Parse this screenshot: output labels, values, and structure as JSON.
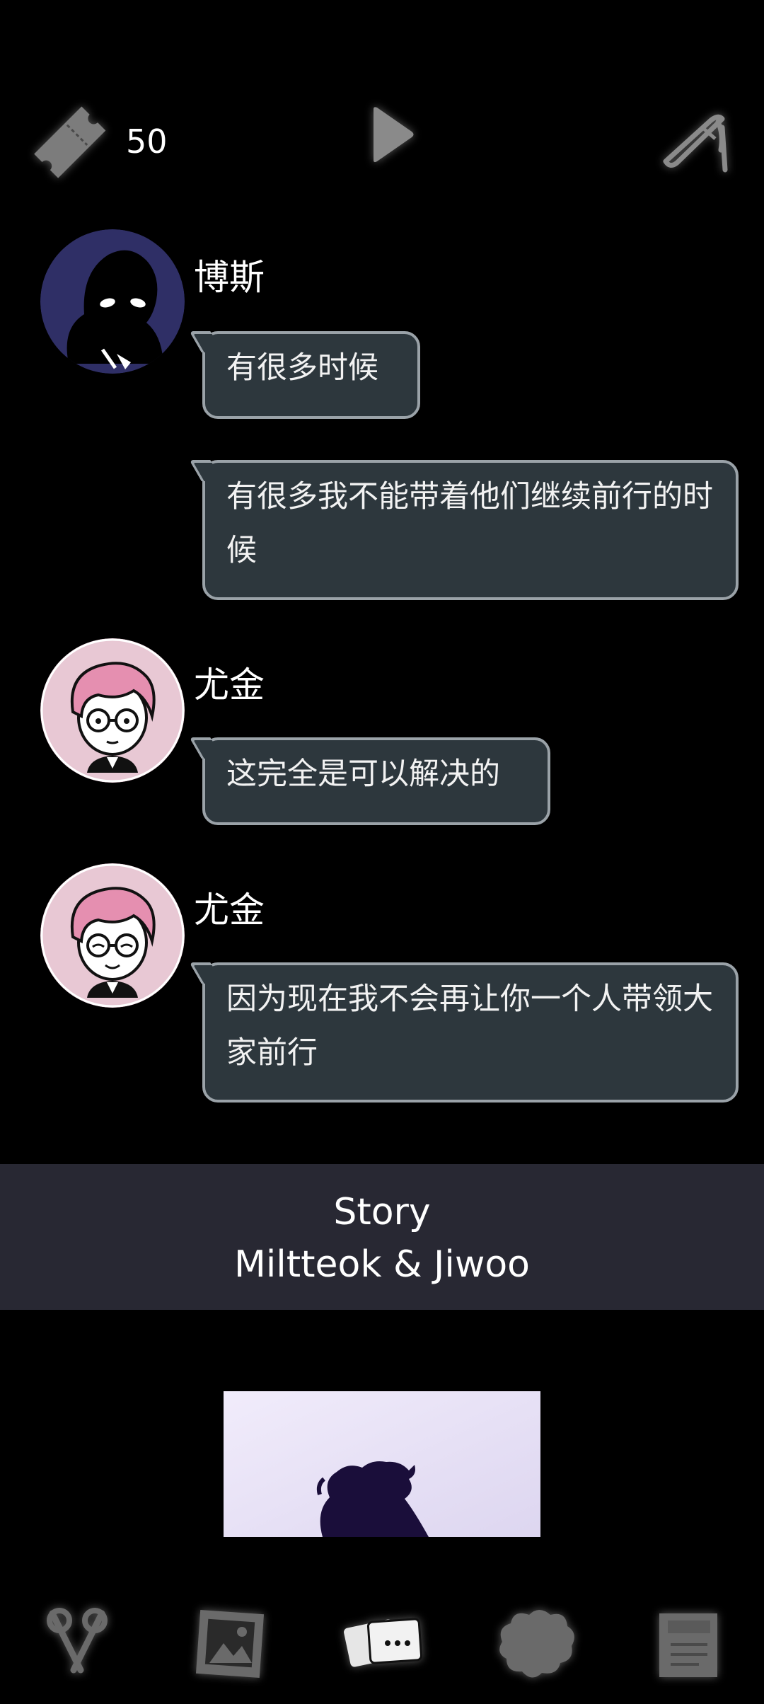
{
  "header": {
    "ticket_count": "50",
    "icons": [
      "ticket-icon",
      "play-icon",
      "quill-icon"
    ]
  },
  "messages": [
    {
      "speaker": "博斯",
      "avatar": "boss-avatar",
      "bubbles": [
        "有很多时候",
        "有很多我不能带着他们继续前行的时候"
      ]
    },
    {
      "speaker": "尤金",
      "avatar": "eugene-avatar",
      "bubbles": [
        "这完全是可以解决的"
      ]
    },
    {
      "speaker": "尤金",
      "avatar": "eugene-avatar-smiling",
      "bubbles": [
        "因为现在我不会再让你一个人带领大家前行"
      ]
    }
  ],
  "banner": {
    "line1": "Story",
    "line2": "Miltteok & Jiwoo"
  },
  "bottom_nav": {
    "items": [
      "scissors-icon",
      "photo-icon",
      "cards-icon",
      "creature-icon",
      "notes-icon"
    ],
    "active": "cards-icon"
  },
  "colors": {
    "background": "#000000",
    "bubble_fill": "#2d373d",
    "bubble_border": "#9aa2a8",
    "banner": "#282833",
    "boss_avatar": "#2f2f66",
    "eugene_avatar": "#e8c8d4"
  }
}
